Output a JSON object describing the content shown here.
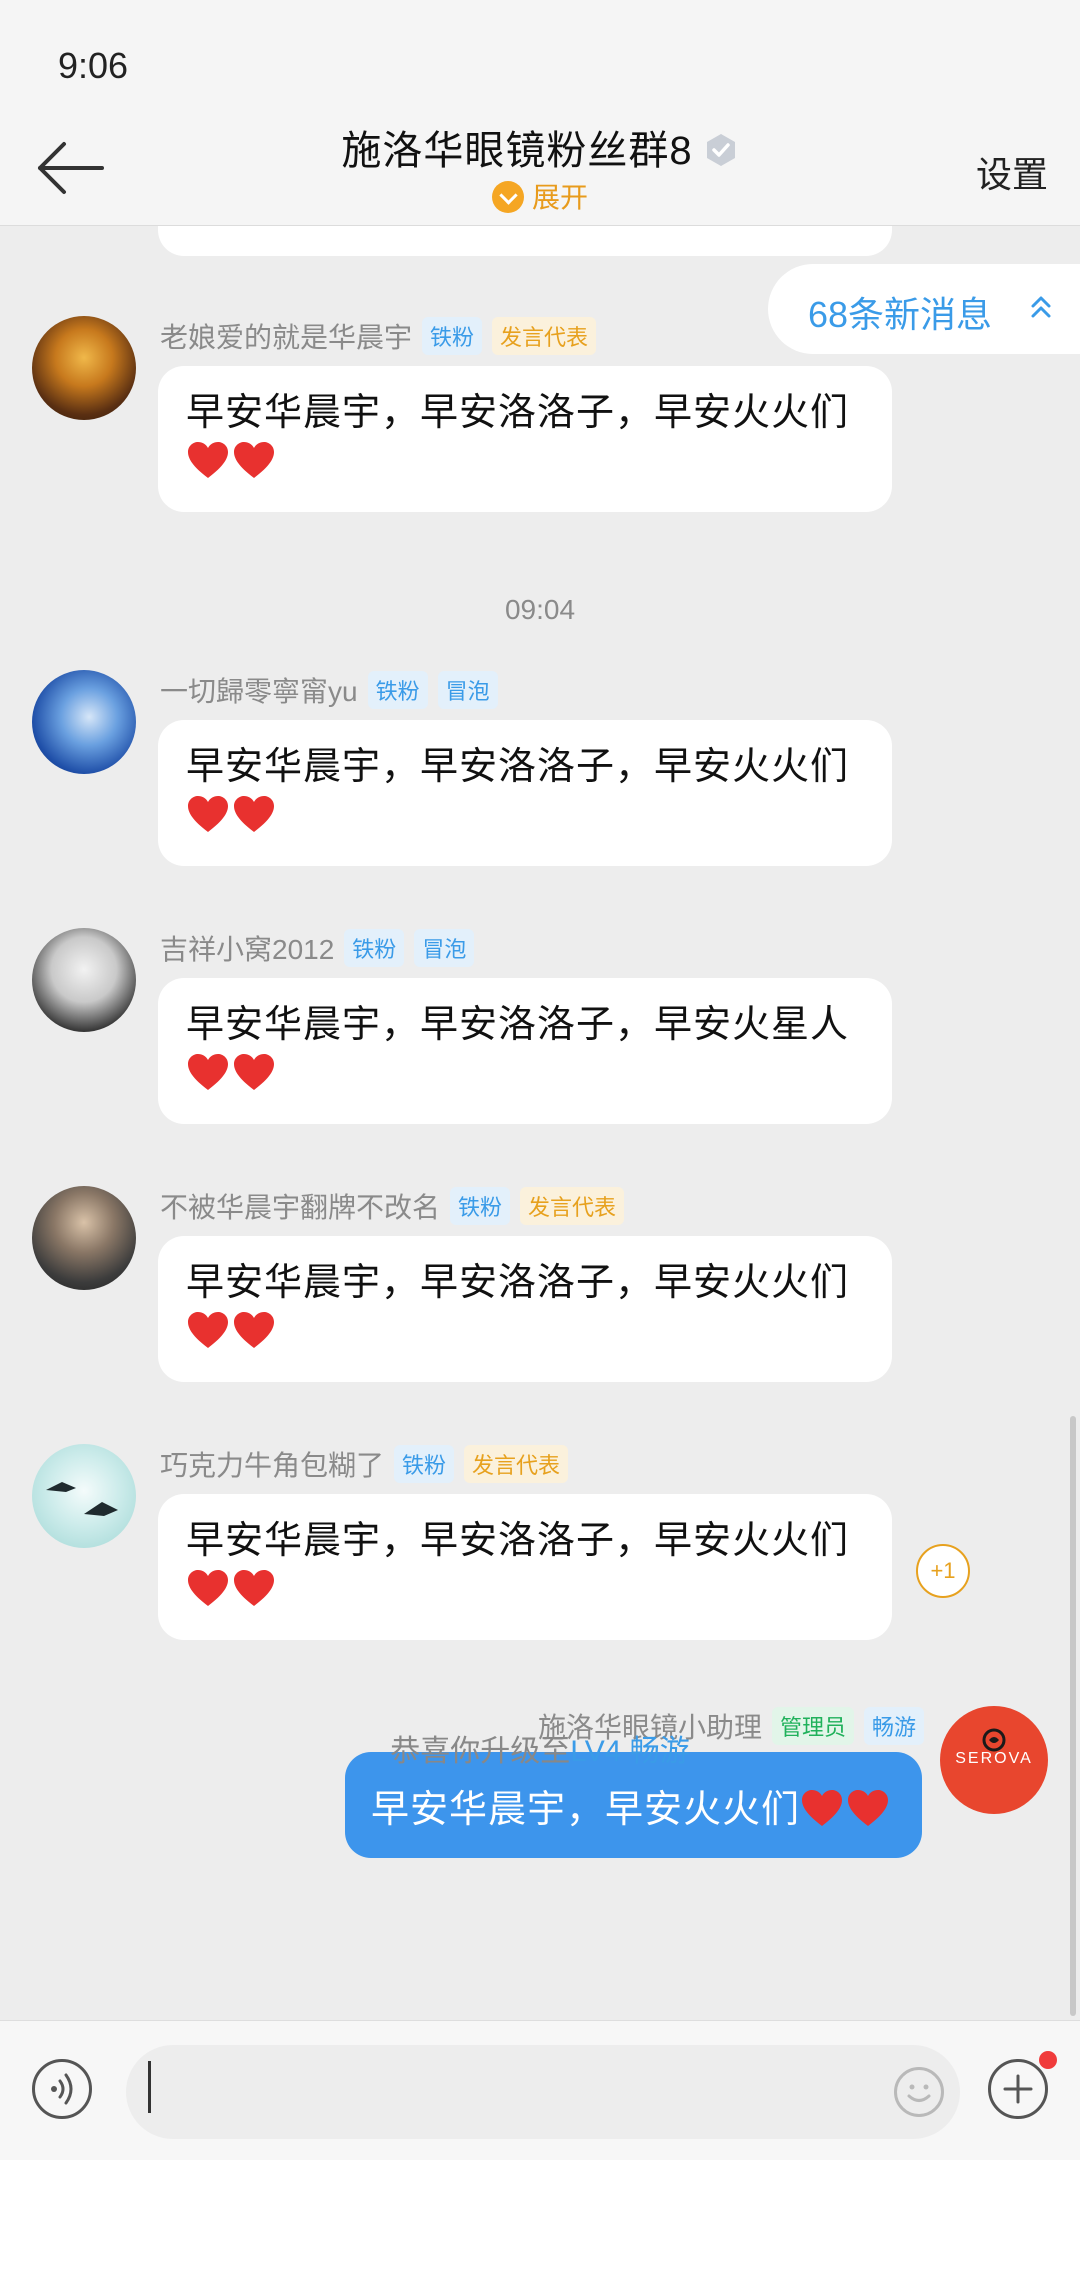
{
  "status_bar": {
    "time": "9:06"
  },
  "header": {
    "title": "施洛华眼镜粉丝群8",
    "expand_label": "展开",
    "settings_label": "设置"
  },
  "new_messages": {
    "label": "68条新消息"
  },
  "time_separator": "09:04",
  "messages": [
    {
      "sender": "老娘爱的就是华晨宇",
      "badges": [
        "铁粉",
        "发言代表"
      ],
      "text": "早安华晨宇，早安洛洛子，早安火火们"
    },
    {
      "sender": "一切歸零寧甯yu",
      "badges": [
        "铁粉",
        "冒泡"
      ],
      "text": "早安华晨宇，早安洛洛子，早安火火们"
    },
    {
      "sender": "吉祥小窝2012",
      "badges": [
        "铁粉",
        "冒泡"
      ],
      "text": "早安华晨宇，早安洛洛子，早安火星人"
    },
    {
      "sender": "不被华晨宇翻牌不改名",
      "badges": [
        "铁粉",
        "发言代表"
      ],
      "text": "早安华晨宇，早安洛洛子，早安火火们"
    },
    {
      "sender": "巧克力牛角包糊了",
      "badges": [
        "铁粉",
        "发言代表"
      ],
      "text": "早安华晨宇，早安洛洛子，早安火火们"
    }
  ],
  "reaction_count": "+1",
  "self_message": {
    "sender": "施洛华眼镜小助理",
    "badges": [
      "管理员",
      "畅游"
    ],
    "text": "早安华晨宇，早安火火们",
    "avatar_text": "SEROVA"
  },
  "system_message": {
    "prefix": "恭喜你升级至",
    "link": "LV4 畅游"
  },
  "colors": {
    "accent_blue": "#3d95ec",
    "badge_orange": "#e7a11e",
    "badge_green": "#20b15b",
    "heart_red": "#e8312f"
  }
}
